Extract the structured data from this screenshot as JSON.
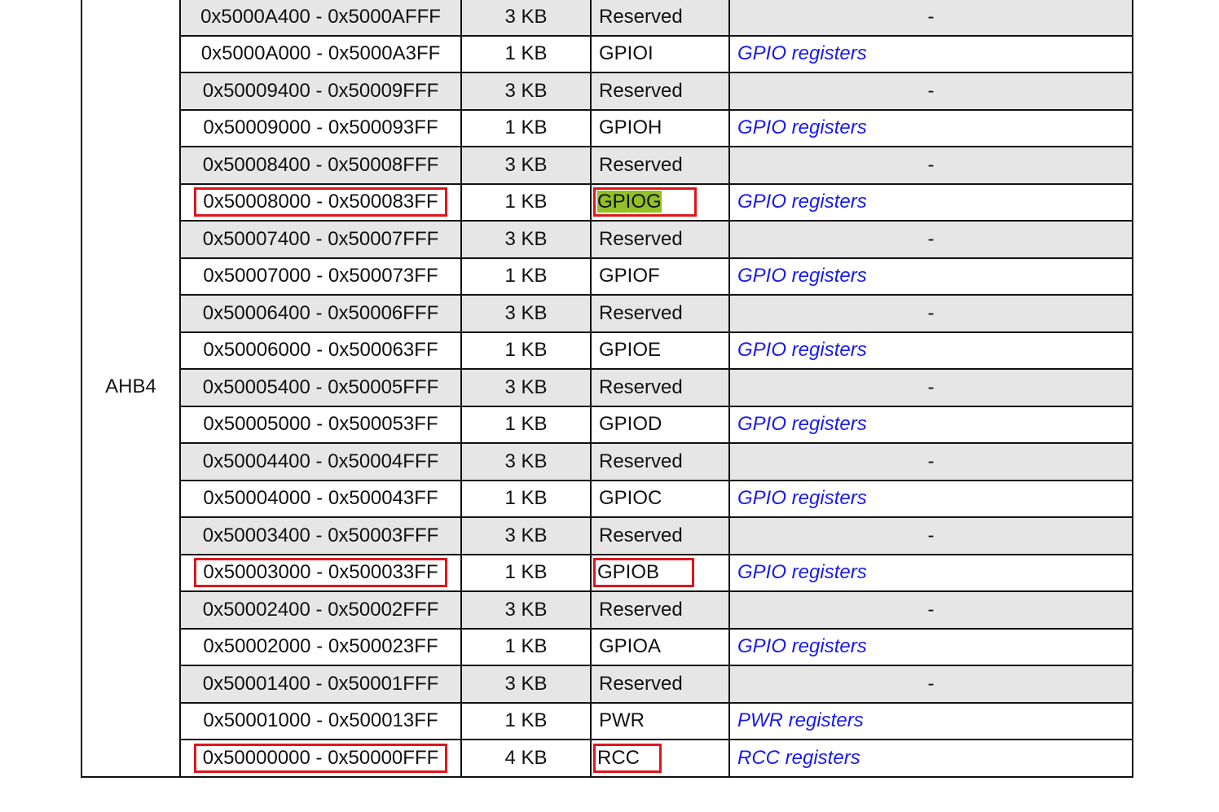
{
  "bus_name": "AHB4",
  "rows": [
    {
      "addr": "0x5000A400 - 0x5000AFFF",
      "size": "3 KB",
      "periph": "Reserved",
      "regmap": "-",
      "reserved": true
    },
    {
      "addr": "0x5000A000 - 0x5000A3FF",
      "size": "1 KB",
      "periph": "GPIOI",
      "regmap": "GPIO registers",
      "reserved": false
    },
    {
      "addr": "0x50009400 - 0x50009FFF",
      "size": "3 KB",
      "periph": "Reserved",
      "regmap": "-",
      "reserved": true
    },
    {
      "addr": "0x50009000 - 0x500093FF",
      "size": "1 KB",
      "periph": "GPIOH",
      "regmap": "GPIO registers",
      "reserved": false
    },
    {
      "addr": "0x50008400 - 0x50008FFF",
      "size": "3 KB",
      "periph": "Reserved",
      "regmap": "-",
      "reserved": true
    },
    {
      "addr": "0x50008000 - 0x500083FF",
      "size": "1 KB",
      "periph": "GPIOG",
      "regmap": "GPIO registers",
      "reserved": false,
      "boxed": true,
      "periph_highlight": true
    },
    {
      "addr": "0x50007400 - 0x50007FFF",
      "size": "3 KB",
      "periph": "Reserved",
      "regmap": "-",
      "reserved": true
    },
    {
      "addr": "0x50007000 - 0x500073FF",
      "size": "1 KB",
      "periph": "GPIOF",
      "regmap": "GPIO registers",
      "reserved": false
    },
    {
      "addr": "0x50006400 - 0x50006FFF",
      "size": "3 KB",
      "periph": "Reserved",
      "regmap": "-",
      "reserved": true
    },
    {
      "addr": "0x50006000 - 0x500063FF",
      "size": "1 KB",
      "periph": "GPIOE",
      "regmap": "GPIO registers",
      "reserved": false
    },
    {
      "addr": "0x50005400 - 0x50005FFF",
      "size": "3 KB",
      "periph": "Reserved",
      "regmap": "-",
      "reserved": true
    },
    {
      "addr": "0x50005000 - 0x500053FF",
      "size": "1 KB",
      "periph": "GPIOD",
      "regmap": "GPIO registers",
      "reserved": false
    },
    {
      "addr": "0x50004400 - 0x50004FFF",
      "size": "3 KB",
      "periph": "Reserved",
      "regmap": "-",
      "reserved": true
    },
    {
      "addr": "0x50004000 - 0x500043FF",
      "size": "1 KB",
      "periph": "GPIOC",
      "regmap": "GPIO registers",
      "reserved": false
    },
    {
      "addr": "0x50003400 - 0x50003FFF",
      "size": "3 KB",
      "periph": "Reserved",
      "regmap": "-",
      "reserved": true
    },
    {
      "addr": "0x50003000 - 0x500033FF",
      "size": "1 KB",
      "periph": "GPIOB",
      "regmap": "GPIO registers",
      "reserved": false,
      "boxed": true
    },
    {
      "addr": "0x50002400 - 0x50002FFF",
      "size": "3 KB",
      "periph": "Reserved",
      "regmap": "-",
      "reserved": true
    },
    {
      "addr": "0x50002000 - 0x500023FF",
      "size": "1 KB",
      "periph": "GPIOA",
      "regmap": "GPIO registers",
      "reserved": false
    },
    {
      "addr": "0x50001400 - 0x50001FFF",
      "size": "3 KB",
      "periph": "Reserved",
      "regmap": "-",
      "reserved": true
    },
    {
      "addr": "0x50001000 - 0x500013FF",
      "size": "1 KB",
      "periph": "PWR",
      "regmap": "PWR registers",
      "reserved": false
    },
    {
      "addr": "0x50000000 - 0x50000FFF",
      "size": "4 KB",
      "periph": "RCC",
      "regmap": "RCC registers",
      "reserved": false,
      "boxed": true
    }
  ],
  "colors": {
    "reserved_row_bg": "#e6e6e6",
    "link": "#1a1aee",
    "highlight_box": "#e0151b",
    "highlight_bg": "#92c026"
  }
}
